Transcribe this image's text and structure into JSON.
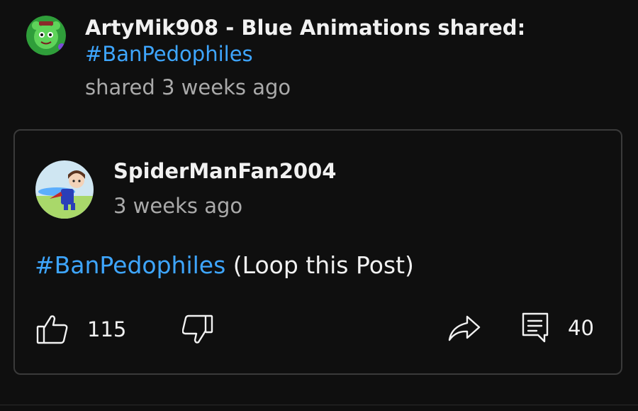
{
  "header": {
    "sharer_name": "ArtyMik908 - Blue Animations shared:",
    "hashtag": "#BanPedophiles",
    "shared_time": "shared 3 weeks ago",
    "sharer_avatar_icon": "green-cartoon-cat-avatar"
  },
  "post": {
    "author_name": "SpiderManFan2004",
    "time": "3 weeks ago",
    "author_avatar_icon": "cartoon-character-avatar",
    "text_hashtag": "#BanPedophiles",
    "text_rest": " (Loop this Post)"
  },
  "actions": {
    "like_count": "115",
    "comment_count": "40",
    "like_icon": "thumbs-up-icon",
    "dislike_icon": "thumbs-down-icon",
    "share_icon": "share-arrow-icon",
    "comment_icon": "comment-icon"
  },
  "colors": {
    "background": "#0f0f0f",
    "link": "#3ea6ff",
    "primary_text": "#f1f1f1",
    "secondary_text": "#aaaaaa",
    "card_border": "#3a3a3a"
  }
}
